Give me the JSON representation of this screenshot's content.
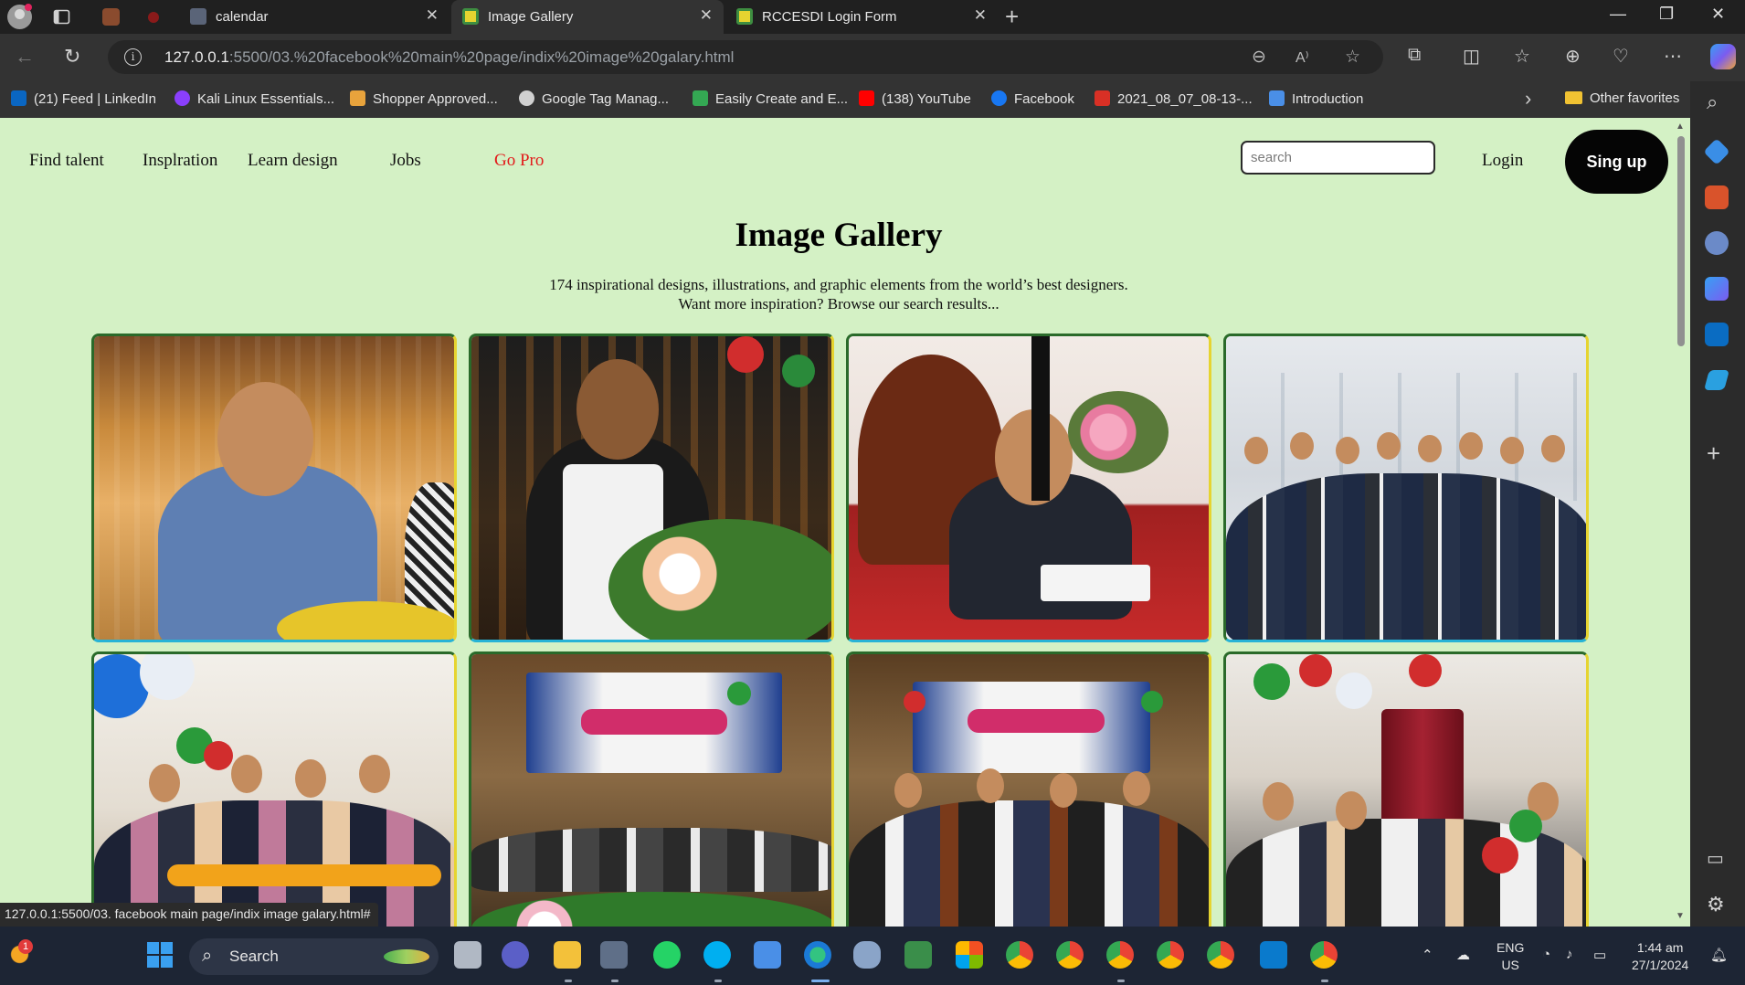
{
  "browser": {
    "tabs": [
      {
        "label": "calendar",
        "favicon_color": "#5a6478",
        "active": false
      },
      {
        "label": "Image Gallery",
        "favicon_color": "#3e8e41",
        "active": true
      },
      {
        "label": "RCCESDI Login Form",
        "favicon_color": "#3e8e41",
        "active": false
      }
    ],
    "url_host": "127.0.0.1",
    "url_rest": ":5500/03.%20facebook%20main%20page/indix%20image%20galary.html",
    "favorites": [
      {
        "label": "(21) Feed | LinkedIn",
        "color": "#0a66c2"
      },
      {
        "label": "Kali Linux Essentials...",
        "color": "#8a3ffc"
      },
      {
        "label": "Shopper Approved...",
        "color": "#e8a33c"
      },
      {
        "label": "Google Tag Manag...",
        "color": "#d0d0d0"
      },
      {
        "label": "Easily Create and E...",
        "color": "#34a853"
      },
      {
        "label": "(138) YouTube",
        "color": "#ff0000"
      },
      {
        "label": "Facebook",
        "color": "#1877f2"
      },
      {
        "label": "2021_08_07_08-13-...",
        "color": "#d93025"
      },
      {
        "label": "Introduction",
        "color": "#4a8fe7"
      }
    ],
    "other_favorites": "Other favorites",
    "status_url": "127.0.0.1:5500/03. facebook main page/indix image galary.html#"
  },
  "site": {
    "nav": [
      "Find talent",
      "Insplration",
      "Learn design",
      "Jobs",
      "Go Pro"
    ],
    "search_placeholder": "search",
    "login": "Login",
    "signup": "Sing up",
    "title": "Image Gallery",
    "subtitle_line1": "174 inspirational designs, illustrations, and graphic elements from the world’s best designers.",
    "subtitle_line2": "Want more inspiration? Browse our search results...",
    "colors": {
      "background": "#d4f1c5",
      "go_pro": "#e21b1b",
      "signup_bg": "#050505"
    }
  },
  "taskbar": {
    "search_label": "Search",
    "lang_line1": "ENG",
    "lang_line2": "US",
    "time": "1:44 am",
    "date": "27/1/2024",
    "notification_count": "1"
  }
}
